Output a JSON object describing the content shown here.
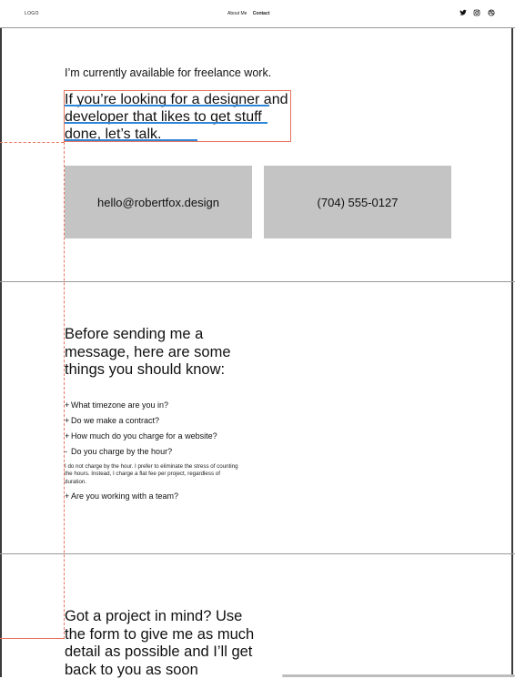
{
  "header": {
    "logo": "LOGO",
    "nav": {
      "about": "About Me",
      "contact": "Contact"
    },
    "social_icons": [
      "twitter-icon",
      "instagram-icon",
      "dribbble-icon"
    ]
  },
  "intro": {
    "availability": "I’m currently available for freelance work.",
    "headline": "If you’re looking for a designer and developer that likes to get stuff done, let’s talk.",
    "email": "hello@robertfox.design",
    "phone": "(704) 555-0127"
  },
  "faq": {
    "heading": "Before sending me a message, here are some things you should know:",
    "items": [
      {
        "symbol": "+",
        "question": "What timezone are you in?"
      },
      {
        "symbol": "+",
        "question": "Do we make a contract?"
      },
      {
        "symbol": "+",
        "question": "How much do you charge for a website?"
      },
      {
        "symbol": "-",
        "question": "Do you charge by the hour?",
        "answer": "I do not charge by the hour. I prefer to eliminate the stress of counting the hours. Instead, I charge a flat fee per project, regardless of duration."
      },
      {
        "symbol": "+",
        "question": "Are you working with a team?"
      }
    ]
  },
  "project": {
    "heading": "Got a project in mind? Use the form to give me as much detail as possible and I’ll get back to you as soon"
  },
  "colors": {
    "card": "#c4c4c4",
    "highlight_box": "#e8735f",
    "underline": "#2f86d6"
  }
}
